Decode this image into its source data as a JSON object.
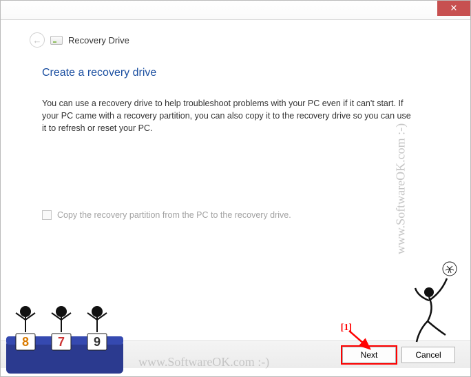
{
  "titlebar": {
    "close_glyph": "✕"
  },
  "header": {
    "back_glyph": "←",
    "title": "Recovery Drive"
  },
  "content": {
    "heading": "Create a recovery drive",
    "body": "You can use a recovery drive to help troubleshoot problems with your PC even if it can't start. If your PC came with a recovery partition, you can also copy it to the recovery drive so you can use it to refresh or reset your PC."
  },
  "checkbox": {
    "label": "Copy the recovery partition from the PC to the recovery drive."
  },
  "buttons": {
    "next": "Next",
    "cancel": "Cancel"
  },
  "annotation": {
    "label": "[1]"
  },
  "watermark": {
    "text": "www.SoftwareOK.com :-)"
  },
  "judges": {
    "cards": [
      "8",
      "7",
      "9"
    ]
  }
}
